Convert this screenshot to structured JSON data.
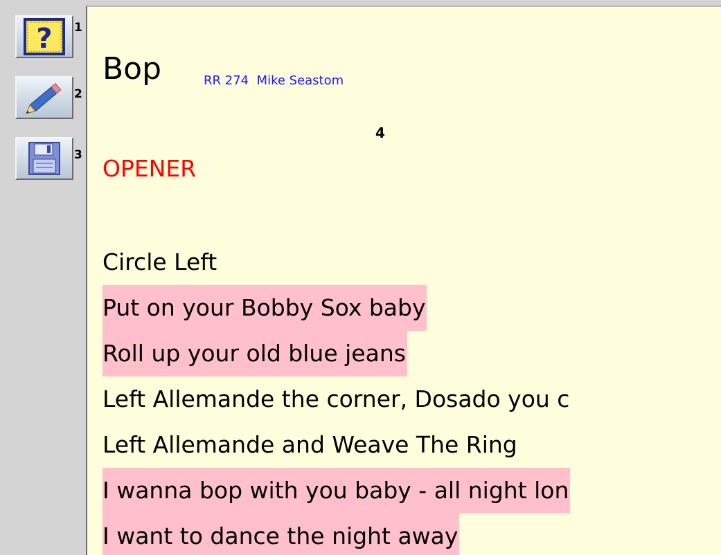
{
  "toolbar": {
    "buttons": [
      {
        "icon": "help-icon",
        "number": "1"
      },
      {
        "icon": "pencil-icon",
        "number": "2"
      },
      {
        "icon": "save-icon",
        "number": "3"
      }
    ]
  },
  "document": {
    "title": "Bop",
    "meta": "RR 274  Mike Seastom",
    "marker": "4",
    "section": "OPENER",
    "lines": [
      {
        "text": "Circle Left",
        "highlight": false
      },
      {
        "text": "Put on your Bobby Sox baby",
        "highlight": true
      },
      {
        "text": "Roll up your old blue jeans",
        "highlight": true
      },
      {
        "text": "Left Allemande the corner, Dosado you c",
        "highlight": false
      },
      {
        "text": "Left Allemande and Weave The Ring",
        "highlight": false
      },
      {
        "text": "I wanna bop with you baby - all night lon",
        "highlight": true
      },
      {
        "text": "I want to dance the night away",
        "highlight": true
      }
    ]
  },
  "colors": {
    "content_bg": "#fffedc",
    "highlight": "#ffc0cb",
    "section": "#ff0000",
    "meta": "#1a1aff",
    "sidebar": "#d4d4d4"
  }
}
